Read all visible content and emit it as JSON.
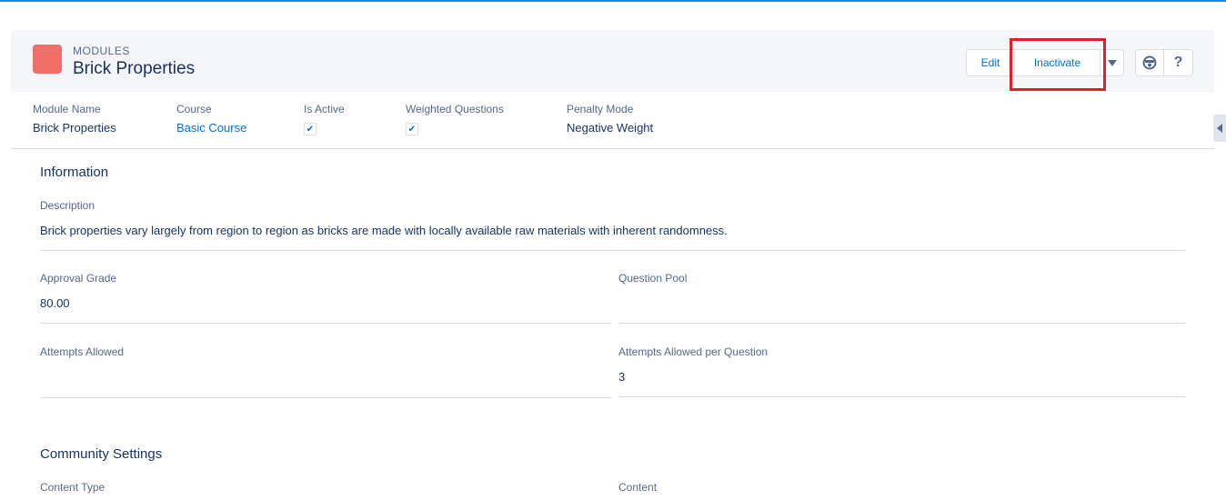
{
  "header": {
    "object_type": "MODULES",
    "record_title": "Brick Properties",
    "actions": {
      "edit_label": "Edit",
      "inactivate_label": "Inactivate",
      "help_label": "?"
    },
    "icon_colors": {
      "object_icon": "#f07069",
      "highlight_box": "#e0202a"
    }
  },
  "highlights": {
    "module_name_label": "Module Name",
    "module_name_value": "Brick Properties",
    "course_label": "Course",
    "course_value": "Basic Course",
    "is_active_label": "Is Active",
    "is_active_checked": true,
    "weighted_questions_label": "Weighted Questions",
    "weighted_questions_checked": true,
    "penalty_mode_label": "Penalty Mode",
    "penalty_mode_value": "Negative Weight"
  },
  "information": {
    "section_title": "Information",
    "description_label": "Description",
    "description_value": "Brick properties vary largely from region to region as bricks are made with locally available raw materials with inherent randomness.",
    "approval_grade_label": "Approval Grade",
    "approval_grade_value": "80.00",
    "question_pool_label": "Question Pool",
    "question_pool_value": "",
    "attempts_allowed_label": "Attempts Allowed",
    "attempts_allowed_value": "",
    "attempts_per_question_label": "Attempts Allowed per Question",
    "attempts_per_question_value": "3"
  },
  "community": {
    "section_title": "Community Settings",
    "content_type_label": "Content Type",
    "content_label": "Content"
  },
  "icons": {
    "check": "✔",
    "object": "module-icon",
    "dropdown": "chevron-down-icon",
    "utility": "assistant-icon",
    "side_panel": "chevron-left-icon"
  }
}
